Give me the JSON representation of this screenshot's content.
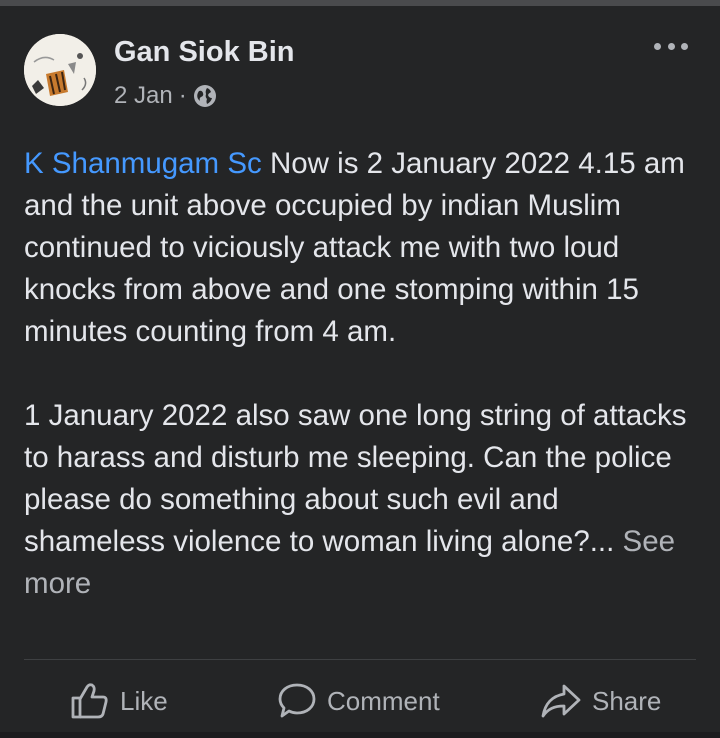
{
  "post": {
    "author": "Gan Siok Bin",
    "date": "2 Jan",
    "separator": "·",
    "mention": "K Shanmugam Sc",
    "paragraph1_rest": " Now is 2 January 2022 4.15 am and the unit above occupied by indian Muslim continued to viciously attack me with two loud knocks from above and one stomping within 15 minutes counting from 4 am.",
    "paragraph2": "1 January 2022 also saw one long string of attacks to harass and disturb me sleeping. Can the police please do something about such evil and shameless violence to woman living alone?...",
    "see_more": " See more"
  },
  "actions": {
    "like": "Like",
    "comment": "Comment",
    "share": "Share"
  },
  "icons": {
    "privacy": "globe-icon",
    "menu": "more-options-icon",
    "like": "thumbs-up-icon",
    "comment": "speech-bubble-icon",
    "share": "share-arrow-icon"
  },
  "colors": {
    "background": "#242526",
    "text": "#e4e6eb",
    "secondary": "#b0b3b8",
    "link": "#4599ff"
  }
}
